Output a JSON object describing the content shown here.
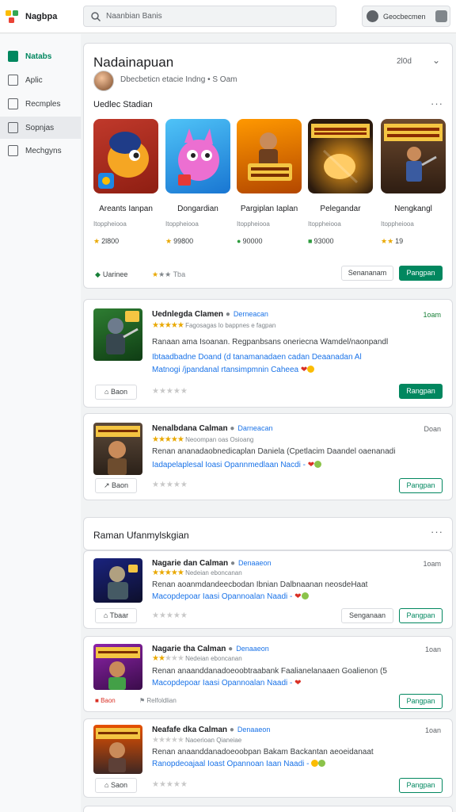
{
  "topbar": {
    "app_name": "Nagbpa",
    "search_placeholder": "Naanbian Banis",
    "account_name": "Geocbecmen"
  },
  "sidebar": {
    "items": [
      {
        "label": "Natabs",
        "active": true
      },
      {
        "label": "Aplic"
      },
      {
        "label": "Recmples"
      },
      {
        "label": "Sopnjas"
      },
      {
        "label": "Mechgyns"
      }
    ]
  },
  "hero": {
    "title": "Nadainapuan",
    "count": "2l0d",
    "subtitle": "Dbecbeticn etacie Indng • S Oam",
    "section_title": "Uedlec Stadian",
    "tiles": [
      {
        "name": "Areants Ianpan",
        "meta": "Itoppheiooa",
        "price": "2l800"
      },
      {
        "name": "Dongardian",
        "meta": "Itoppheiooa",
        "price": "99800"
      },
      {
        "name": "Pargiplan Iaplan",
        "meta": "Itoppheiooa",
        "price": "90000"
      },
      {
        "name": "Pelegandar",
        "meta": "Itoppheiooa",
        "price": "93000"
      },
      {
        "name": "Nengkangl",
        "meta": "Itoppheiooa",
        "price": "19"
      }
    ],
    "foot_left": "Uarinee",
    "foot_right": "Tba",
    "btn_secondary": "Senananam",
    "btn_primary": "Pangpan"
  },
  "apps_top": [
    {
      "title": "Uednlegda Clamen",
      "dev": "Derneacan",
      "date": "1oam",
      "rating_text": "Fagosagas lo bappnes e fagpan",
      "desc1": "Ranaan ama Isoanan. Regpanbsans oneriecna Wamdel/naonpandl",
      "desc2": "Ibtaadbadne Doand (d tanamanadaen cadan Deaanadan Al",
      "desc3": "Matnogi /jpandanal rtansimpmnin Caheea",
      "chip": "Baon",
      "btn": "Rangpan"
    },
    {
      "title": "Nenalbdana Calman",
      "dev": "Darneacan",
      "date": "Doan",
      "rating_text": "Neoompan oas Osioang",
      "desc1": "Renan ananadaobnedicaplan Daniela (Cpetlacim Daandel oaenanadi",
      "desc2": "Iadapelaplesal Ioasi Opannmedlaan Nacdi -",
      "desc3": "",
      "chip": "Baon",
      "btn": "Pangpan"
    }
  ],
  "section": {
    "title": "Raman Ufanmylskgian"
  },
  "apps_bottom": [
    {
      "title": "Nagarie dan Calman",
      "dev": "Denaaeon",
      "date": "1oam",
      "rating_text": "Nedeian eboncanan",
      "desc1": "Renan aoanmdandeecbodan Ibnian Dalbnaanan neosdeHaat",
      "desc2": "Macopdepoar Iaasi Opannoalan Naadi -",
      "chip": "Tbaar",
      "btn_secondary": "Senganaan",
      "btn": "Pangpan"
    },
    {
      "title": "Nagarie tha Calman",
      "dev": "Denaaeon",
      "date": "1oan",
      "rating_text": "Nedeian eboncanan",
      "desc1": "Renan anaanddanadoeoobtraabank Faalianelanaaen Goalienon (5",
      "desc2": "Macopdepoar Iaasi Opannoalan Naadi -",
      "foot_left": "Baon",
      "foot_right": "Relfoldlian",
      "btn": "Pangpan"
    },
    {
      "title": "Neafafe dka Calman",
      "dev": "Denaaeon",
      "date": "1oan",
      "rating_text": "Naoerioan Qianeiae",
      "desc1": "Renan anaanddanadoeoobpan Bakam Backantan aeoeidanaat",
      "desc2": "Ranopdeoajaal Ioast Opannoan Iaan Naadi -",
      "chip": "Saon",
      "btn": "Pangpan"
    }
  ]
}
